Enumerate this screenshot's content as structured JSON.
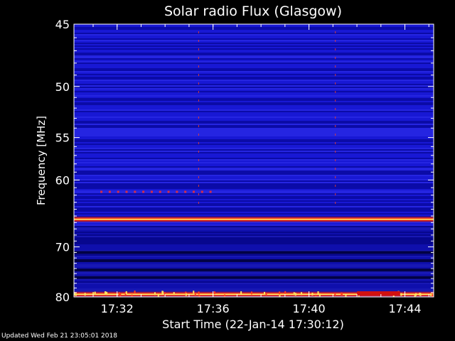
{
  "chart_data": {
    "type": "heatmap",
    "title": "Solar radio Flux (Glasgow)",
    "xlabel": "Start Time (22-Jan-14 17:30:12)",
    "ylabel": "Frequency [MHz]",
    "x_ticks": [
      "17:32",
      "17:36",
      "17:40",
      "17:44"
    ],
    "x_tick_minutes": [
      1.8,
      5.8,
      9.8,
      13.8
    ],
    "x_range_minutes": [
      0,
      15
    ],
    "y_ticks": [
      45,
      50,
      55,
      60,
      70,
      80
    ],
    "ylim": [
      45,
      80
    ],
    "features": {
      "strong_bands_mhz": [
        65.5,
        79.4
      ],
      "dark_bands_mhz": [
        71,
        72.5,
        74.3,
        75.8
      ],
      "burst_line_minutes": [
        5.2,
        10.9
      ],
      "dot_row_mhz": 61.5,
      "bottom_segment_minutes": [
        11.8,
        13.6
      ]
    },
    "colors": {
      "background": "#1010c8",
      "band": "#ff3000",
      "band_core": "#ffff80",
      "dark": "#000030"
    }
  },
  "footer": "Updated Wed Feb 21 23:05:01 2018"
}
